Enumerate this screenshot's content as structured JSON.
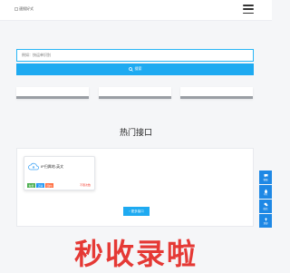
{
  "header": {
    "logo_alt": "速搜好式",
    "menu_icon": "hamburger-icon"
  },
  "search": {
    "placeholder": "例如：快运单识别",
    "button_label": "搜索",
    "button_icon": "search-icon"
  },
  "section": {
    "title": "热门接口"
  },
  "apis": [
    {
      "icon": "cloud-icon",
      "name": "IP归属地-英文",
      "tags": [
        "免费",
        "正版",
        "国内"
      ],
      "remaining": "不限次数"
    }
  ],
  "more_button": {
    "label": "更多接口",
    "icon": "arrow-icon"
  },
  "float_bar": [
    {
      "icon": "chat-icon",
      "label": "客服"
    },
    {
      "icon": "water-icon",
      "label": "QQ"
    },
    {
      "icon": "wechat-icon",
      "label": "微信"
    },
    {
      "icon": "top-icon",
      "label": "顶部"
    }
  ],
  "watermark": "秒收录啦",
  "colors": {
    "accent": "#1eaaf1",
    "watermark": "#e53935",
    "float": "#1e88e5"
  }
}
